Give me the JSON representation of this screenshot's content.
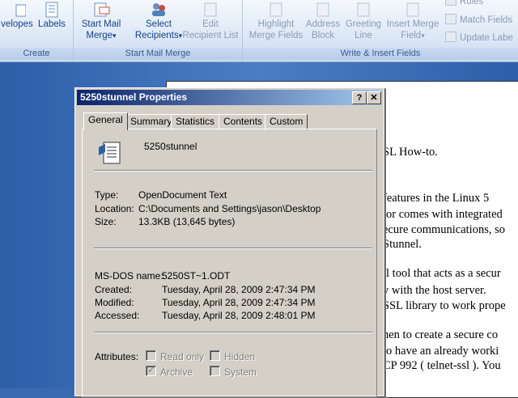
{
  "ribbon": {
    "groups": {
      "create": "Create",
      "start_mail_merge": "Start Mail Merge",
      "write_insert": "Write & Insert Fields"
    },
    "buttons": {
      "envelopes": "velopes",
      "labels": "Labels",
      "start_mail_merge_1": "Start Mail",
      "start_mail_merge_2": "Merge",
      "select_recipients_1": "Select",
      "select_recipients_2": "Recipients",
      "edit_recipient_1": "Edit",
      "edit_recipient_2": "Recipient List",
      "highlight_1": "Highlight",
      "highlight_2": "Merge Fields",
      "address_1": "Address",
      "address_2": "Block",
      "greeting_1": "Greeting",
      "greeting_2": "Line",
      "insert_merge_1": "Insert Merge",
      "insert_merge_2": "Field",
      "rules": "Rules",
      "match_fields": "Match Fields",
      "update_labels": "Update Labe"
    },
    "dropdown_glyph": "▾"
  },
  "document": {
    "lines": [
      "SL How-to.",
      "features in the Linux 5",
      "tor comes with integrated",
      "ecure communications, so",
      "Stunnel.",
      "il tool that acts as a secur",
      "y with the host server.",
      "SSL library to work prope",
      "hen to create a secure co",
      "to have an already worki",
      "CP 992 ( telnet-ssl ). You"
    ]
  },
  "dialog": {
    "title": "5250stunnel Properties",
    "help_glyph": "?",
    "close_glyph": "✕",
    "tabs": [
      "General",
      "Summary",
      "Statistics",
      "Contents",
      "Custom"
    ],
    "active_tab": "General",
    "file_name": "5250stunnel",
    "type_label": "Type:",
    "type_value": "OpenDocument Text",
    "location_label": "Location:",
    "location_value": "C:\\Documents and Settings\\jason\\Desktop",
    "size_label": "Size:",
    "size_value": "13.3KB (13,645 bytes)",
    "msdos_label": "MS-DOS name:",
    "msdos_value": "5250ST~1.ODT",
    "created_label": "Created:",
    "created_value": "Tuesday, April 28, 2009 2:47:34 PM",
    "modified_label": "Modified:",
    "modified_value": "Tuesday, April 28, 2009 2:47:34 PM",
    "accessed_label": "Accessed:",
    "accessed_value": "Tuesday, April 28, 2009 2:48:01 PM",
    "attributes_label": "Attributes:",
    "attributes": {
      "read_only": "Read only",
      "hidden": "Hidden",
      "archive": "Archive",
      "system": "System"
    },
    "archive_checked": true,
    "check_glyph": "✓"
  }
}
